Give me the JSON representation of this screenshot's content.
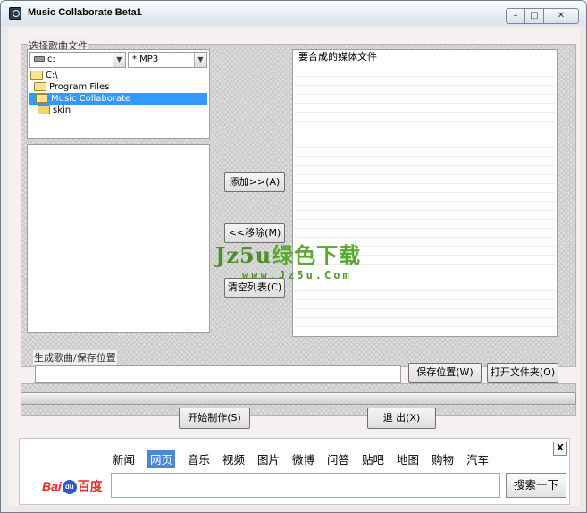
{
  "window": {
    "title": "Music Collaborate Beta1",
    "controls": [
      "–",
      "□",
      "✕"
    ]
  },
  "source": {
    "group_label": "选择歌曲文件",
    "drive": "c:",
    "filter": "*.MP3",
    "tree": [
      "C:\\",
      "Program Files",
      "Music Collaborate",
      "skin"
    ],
    "selected_index": 2
  },
  "actions": {
    "add": "添加>>(A)",
    "remove": "<<移除(M)",
    "clear": "清空列表(C)"
  },
  "target_list": {
    "header": "要合成的媒体文件"
  },
  "output": {
    "group_label": "生成歌曲/保存位置",
    "path_value": "",
    "save_location": "保存位置(W)",
    "open_folder": "打开文件夹(O)"
  },
  "progress": {
    "value": 0
  },
  "bottom": {
    "start": "开始制作(S)",
    "exit": "退 出(X)"
  },
  "watermark": {
    "line1_latin": "Jz5u",
    "line1_cn": "绿色下载",
    "line2": "www.Jz5u.Com"
  },
  "baidu": {
    "nav": [
      "新闻",
      "网页",
      "音乐",
      "视频",
      "图片",
      "微博",
      "问答",
      "贴吧",
      "地图",
      "购物",
      "汽车"
    ],
    "active_nav": "网页",
    "logo_bai": "Bai",
    "logo_du": "du",
    "logo_cn": "百度",
    "close": "X",
    "search_button": "搜索一下",
    "search_value": ""
  },
  "colors": {
    "selection": "#3399ff",
    "watermark_green": "#59a831",
    "baidu_red": "#e42a22",
    "baidu_blue": "#2b57d1"
  }
}
